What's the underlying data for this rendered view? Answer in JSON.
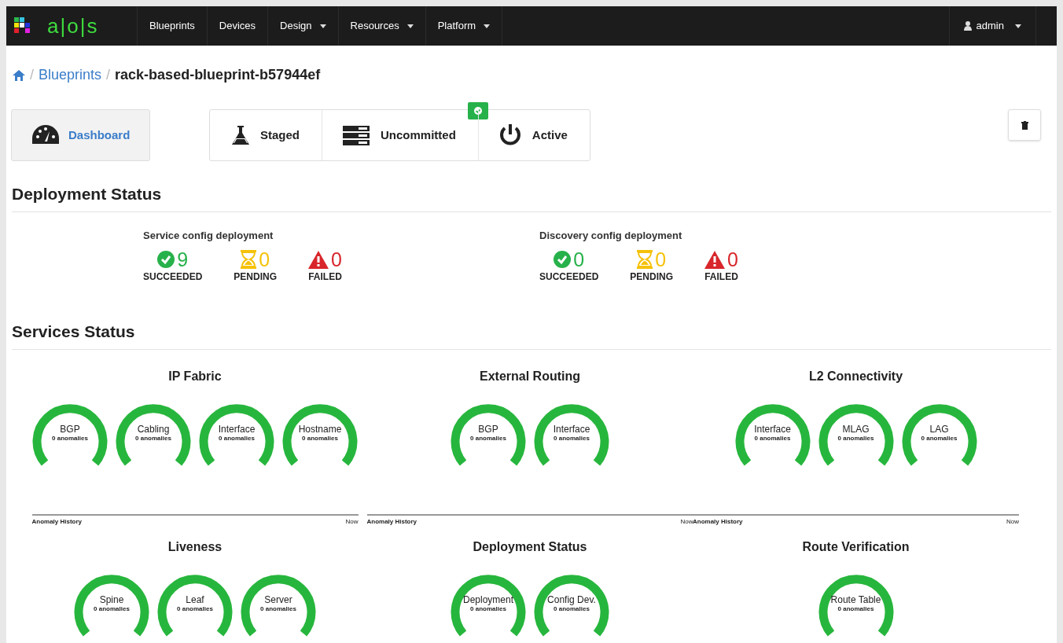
{
  "navbar": {
    "logo": "a|o|s",
    "items": [
      {
        "label": "Blueprints",
        "dropdown": false
      },
      {
        "label": "Devices",
        "dropdown": false
      },
      {
        "label": "Design",
        "dropdown": true
      },
      {
        "label": "Resources",
        "dropdown": true
      },
      {
        "label": "Platform",
        "dropdown": true
      }
    ],
    "user": "admin"
  },
  "breadcrumb": [
    "Blueprints",
    "rack-based-blueprint-b57944ef"
  ],
  "breadcrumb_separator": "/",
  "dashboard_tab": {
    "label": "Dashboard",
    "selected": true
  },
  "steps": [
    {
      "kind": "staged",
      "label": "Staged",
      "badge": false
    },
    {
      "kind": "uncommitted",
      "label": "Uncommitted",
      "badge": true
    },
    {
      "kind": "active",
      "label": "Active",
      "badge": false
    }
  ],
  "deployment_status": {
    "title": "Deployment Status",
    "panels": [
      {
        "title": "Service config deployment",
        "stats": [
          {
            "kind": "succeeded",
            "value": "9",
            "label": "SUCCEEDED"
          },
          {
            "kind": "pending",
            "value": "0",
            "label": "PENDING"
          },
          {
            "kind": "failed",
            "value": "0",
            "label": "FAILED"
          }
        ]
      },
      {
        "title": "Discovery config deployment",
        "stats": [
          {
            "kind": "succeeded",
            "value": "0",
            "label": "SUCCEEDED"
          },
          {
            "kind": "pending",
            "value": "0",
            "label": "PENDING"
          },
          {
            "kind": "failed",
            "value": "0",
            "label": "FAILED"
          }
        ]
      }
    ]
  },
  "services_status": {
    "title": "Services Status",
    "groups": [
      {
        "title": "IP Fabric",
        "gauges": [
          {
            "name": "BGP",
            "anomalies": "0 anomalies"
          },
          {
            "name": "Cabling",
            "anomalies": "0 anomalies"
          },
          {
            "name": "Interface",
            "anomalies": "0 anomalies"
          },
          {
            "name": "Hostname",
            "anomalies": "0 anomalies"
          }
        ],
        "history": {
          "label": "Anomaly History",
          "end": "Now"
        }
      },
      {
        "title": "External Routing",
        "gauges": [
          {
            "name": "BGP",
            "anomalies": "0 anomalies"
          },
          {
            "name": "Interface",
            "anomalies": "0 anomalies"
          }
        ],
        "history": {
          "label": "Anomaly History",
          "end": "Now"
        }
      },
      {
        "title": "L2 Connectivity",
        "gauges": [
          {
            "name": "Interface",
            "anomalies": "0 anomalies"
          },
          {
            "name": "MLAG",
            "anomalies": "0 anomalies"
          },
          {
            "name": "LAG",
            "anomalies": "0 anomalies"
          }
        ],
        "history": {
          "label": "Anomaly History",
          "end": "Now"
        }
      },
      {
        "title": "Liveness",
        "gauges": [
          {
            "name": "Spine",
            "anomalies": "0 anomalies"
          },
          {
            "name": "Leaf",
            "anomalies": "0 anomalies"
          },
          {
            "name": "Server",
            "anomalies": "0 anomalies"
          }
        ]
      },
      {
        "title": "Deployment Status",
        "gauges": [
          {
            "name": "Deployment",
            "anomalies": "0 anomalies"
          },
          {
            "name": "Config Dev.",
            "anomalies": "0 anomalies"
          }
        ]
      },
      {
        "title": "Route Verification",
        "gauges": [
          {
            "name": "Route Table",
            "anomalies": "0 anomalies"
          }
        ]
      }
    ]
  }
}
